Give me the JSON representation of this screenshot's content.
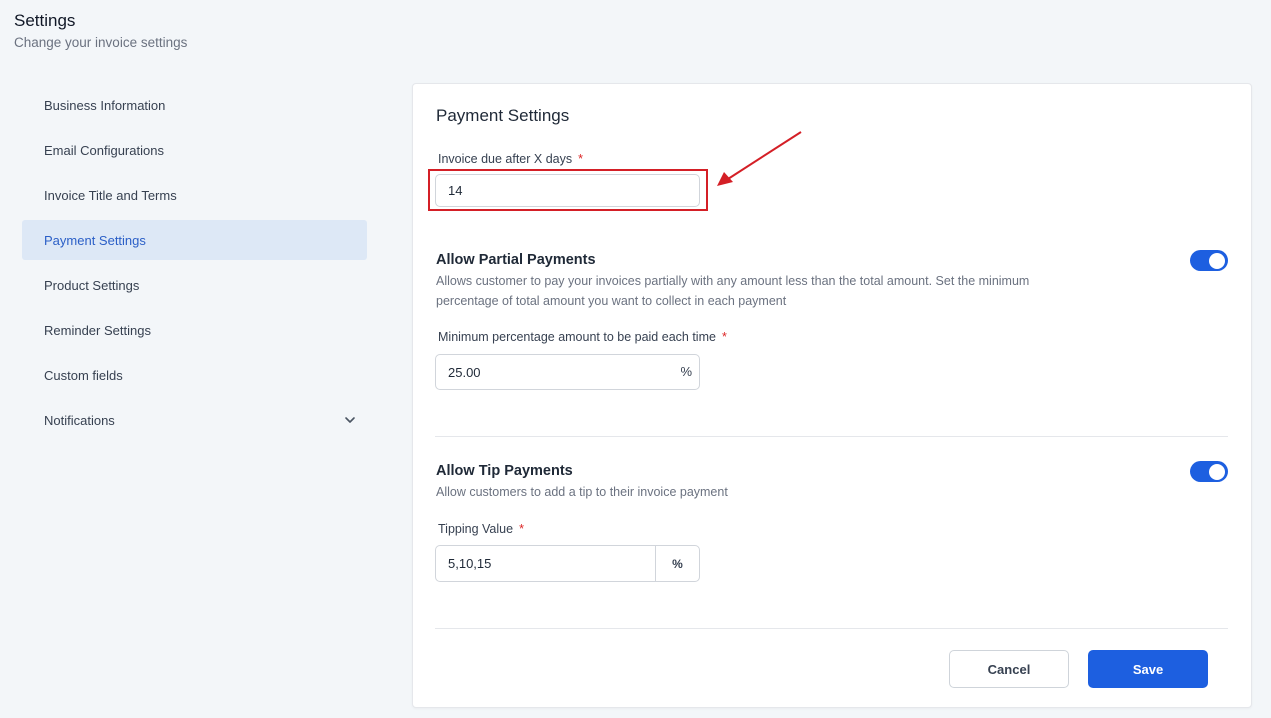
{
  "header": {
    "title": "Settings",
    "subtitle": "Change your invoice settings"
  },
  "sidebar": {
    "items": [
      {
        "label": "Business Information"
      },
      {
        "label": "Email Configurations"
      },
      {
        "label": "Invoice Title and Terms"
      },
      {
        "label": "Payment Settings",
        "active": true
      },
      {
        "label": "Product Settings"
      },
      {
        "label": "Reminder Settings"
      },
      {
        "label": "Custom fields"
      },
      {
        "label": "Notifications",
        "icon": "chevron-down-icon"
      }
    ]
  },
  "card": {
    "title": "Payment Settings",
    "due_days": {
      "label": "Invoice due after X days",
      "required_mark": "*",
      "value": "14"
    },
    "partial": {
      "title": "Allow Partial Payments",
      "desc": "Allows customer to pay your invoices partially with any amount less than the total amount. Set the minimum percentage of total amount you want to collect in each payment",
      "enabled": true,
      "min_label": "Minimum percentage amount to be paid each time",
      "required_mark": "*",
      "min_value": "25.00",
      "min_suffix": "%"
    },
    "tip": {
      "title": "Allow Tip Payments",
      "desc": "Allow customers to add a tip to their invoice payment",
      "enabled": true,
      "value_label": "Tipping Value",
      "required_mark": "*",
      "value": "5,10,15",
      "addon": "%"
    },
    "actions": {
      "cancel": "Cancel",
      "save": "Save"
    }
  },
  "colors": {
    "accent": "#1d5fe0",
    "active_bg": "#dde8f6",
    "annotation": "#d41f26",
    "required": "#dc2626"
  }
}
